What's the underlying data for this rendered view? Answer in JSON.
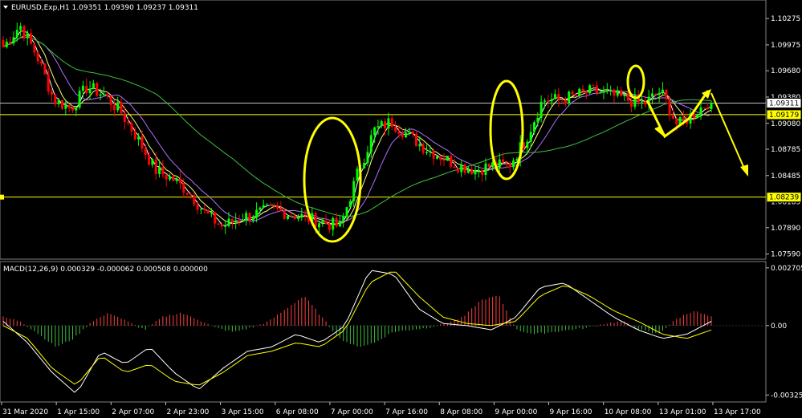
{
  "window": {
    "symbol_line": "EURUSD,Exp,H1  1.09351 1.09390 1.09237 1.09311",
    "menu_icon": "triangle-down-icon"
  },
  "colors": {
    "background": "#000000",
    "bull": "#00ff00",
    "bear": "#ff0000",
    "ma_fast": "#ffffff",
    "ma_mid": "#ffff80",
    "ma_slow": "#b070ff",
    "ma_long": "#40c040",
    "annotation": "#ffff00",
    "macd_pos": "#ff4040",
    "macd_neg": "#40c040",
    "grid": "#c0c0c0"
  },
  "price_axis": {
    "ticks": [
      "1.10275",
      "1.09975",
      "1.09680",
      "1.09380",
      "1.09080",
      "1.08785",
      "1.08485",
      "1.08185",
      "1.07890",
      "1.07590"
    ],
    "current_price": "1.09311",
    "level_1": "1.09179",
    "level_2": "1.08239"
  },
  "macd": {
    "label": "MACD(12,26,9) 0.000329 -0.000062 0.000508 0.000000",
    "ticks": [
      "0.002705",
      "0.00",
      "-0.00325"
    ]
  },
  "time_axis": {
    "ticks": [
      "31 Mar 2020",
      "1 Apr 15:00",
      "2 Apr 07:00",
      "2 Apr 23:00",
      "3 Apr 15:00",
      "6 Apr 08:00",
      "7 Apr 00:00",
      "7 Apr 16:00",
      "8 Apr 08:00",
      "9 Apr 00:00",
      "9 Apr 16:00",
      "10 Apr 08:00",
      "13 Apr 01:00",
      "13 Apr 17:00"
    ]
  },
  "chart_data": [
    {
      "type": "candlestick",
      "title": "EURUSD,Exp,H1",
      "ohlc_last": {
        "open": 1.09351,
        "high": 1.0939,
        "low": 1.09237,
        "close": 1.09311
      },
      "ylim": [
        1.0755,
        1.1045
      ],
      "close_path": [
        1.0995,
        1.102,
        1.0985,
        1.0935,
        1.0925,
        1.095,
        1.094,
        1.092,
        1.089,
        1.0855,
        1.0845,
        1.083,
        1.0805,
        1.079,
        1.08,
        1.0805,
        1.081,
        1.0805,
        1.08,
        1.0795,
        1.079,
        1.085,
        1.09,
        1.091,
        1.0895,
        1.088,
        1.087,
        1.086,
        1.0855,
        1.086,
        1.086,
        1.089,
        1.0935,
        1.0935,
        1.094,
        1.0945,
        1.094,
        1.0935,
        1.093,
        1.0945,
        1.0905,
        1.092,
        1.0935
      ],
      "horizontal_levels": [
        1.09311,
        1.09179,
        1.08239
      ]
    },
    {
      "type": "bar",
      "title": "MACD(12,26,9)",
      "values_label": [
        0.000329,
        -6.2e-05,
        0.000508,
        0.0
      ],
      "ylim": [
        -0.0035,
        0.00285
      ],
      "hist_path": [
        0.0004,
        0.0002,
        -0.0004,
        -0.001,
        -0.0006,
        0.0002,
        0.0006,
        0.0002,
        -0.0002,
        0.0004,
        0.0006,
        0.0003,
        -0.0001,
        -0.0003,
        -0.0001,
        0.0002,
        0.0008,
        0.0014,
        0.0004,
        -0.0006,
        -0.001,
        -0.0008,
        -0.0003,
        -0.0002,
        -0.0001,
        0.0001,
        0.0004,
        0.0012,
        0.0014,
        -0.0002,
        -0.0004,
        -0.0003,
        -0.0002,
        -0.0001,
        0.0001,
        0.0002,
        -0.0002,
        -0.0004,
        0.0003,
        0.0007,
        0.0004
      ],
      "macd_path": [
        0.0002,
        -0.0008,
        -0.0022,
        -0.0032,
        -0.0012,
        -0.0018,
        -0.001,
        -0.0022,
        -0.003,
        -0.002,
        -0.0012,
        -0.001,
        -0.0004,
        -0.0008,
        0.0,
        0.0026,
        0.0024,
        0.0008,
        0.0001,
        0.0,
        -0.0002,
        0.0004,
        0.0018,
        0.002,
        0.0012,
        0.0004,
        -0.0002,
        -0.0006,
        -0.0004,
        0.0002
      ],
      "signal_path": [
        0.0,
        -0.0006,
        -0.002,
        -0.0028,
        -0.0014,
        -0.0022,
        -0.0018,
        -0.0026,
        -0.0028,
        -0.0022,
        -0.0014,
        -0.0012,
        -0.0008,
        -0.001,
        -0.0002,
        0.002,
        0.0026,
        0.0014,
        0.0004,
        0.0001,
        0.0,
        0.0002,
        0.0014,
        0.0019,
        0.0014,
        0.0007,
        0.0002,
        -0.0004,
        -0.0006,
        -0.0002
      ]
    }
  ]
}
